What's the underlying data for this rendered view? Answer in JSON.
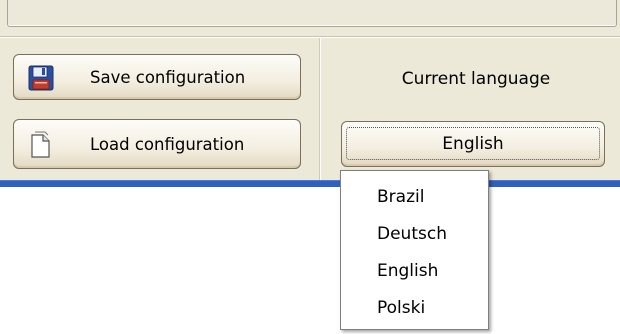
{
  "buttons": {
    "save": {
      "label": "Save configuration",
      "icon": "floppy-disk-icon"
    },
    "load": {
      "label": "Load configuration",
      "icon": "document-icon"
    }
  },
  "language": {
    "label": "Current language",
    "selected": "English",
    "options": [
      "Brazil",
      "Deutsch",
      "English",
      "Polski"
    ]
  },
  "colors": {
    "window_bg": "#ece9d8",
    "accent_bar": "#2f5fbf"
  }
}
